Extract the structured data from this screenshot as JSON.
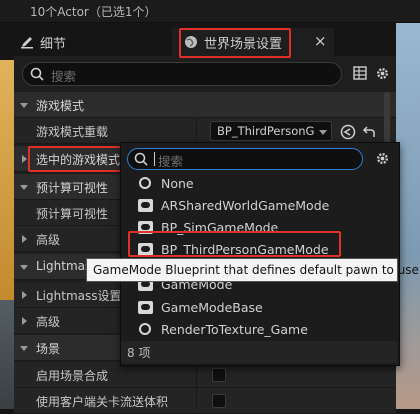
{
  "outliner": {
    "status": "10个Actor（已选1个）"
  },
  "tabs": [
    {
      "label": "细节"
    },
    {
      "label": "世界场景设置"
    }
  ],
  "search": {
    "placeholder": "搜索"
  },
  "rows": {
    "cat_game_mode": "游戏模式",
    "game_mode_override": "游戏模式重载",
    "game_mode_override_value": "BP_ThirdPersonG",
    "selected_game_mode": "选中的游戏模式",
    "precomputed_visibility": "预计算可视性",
    "precomputed_visibility_sub": "预计算可视性",
    "advanced1": "高级",
    "lightmass": "Lightmass",
    "lightmass_settings": "Lightmass设置",
    "advanced2": "高级",
    "scene": "场景",
    "enable_scene_composition": "启用场景合成",
    "client_level_streaming": "使用客户端关卡流送体积"
  },
  "dropdown": {
    "search_placeholder": "搜索",
    "items": [
      {
        "label": "None",
        "icon": "circle-icon"
      },
      {
        "label": "ARSharedWorldGameMode",
        "icon": "gamepad-icon"
      },
      {
        "label": "BP_SimGameMode",
        "icon": "gamepad-icon"
      },
      {
        "label": "BP_ThirdPersonGameMode",
        "icon": "gamepad-icon"
      },
      {
        "label": "GameMode",
        "icon": "gamepad-icon"
      },
      {
        "label": "GameModeBase",
        "icon": "gamepad-icon"
      },
      {
        "label": "RenderToTexture_Game",
        "icon": "circle-icon"
      }
    ],
    "count": "8 项"
  },
  "tooltip": "GameMode Blueprint that defines default pawn to use.",
  "colors": {
    "highlight": "#e0302a",
    "panel": "#1e1e1e",
    "accent_blue": "#2f7fd6"
  }
}
